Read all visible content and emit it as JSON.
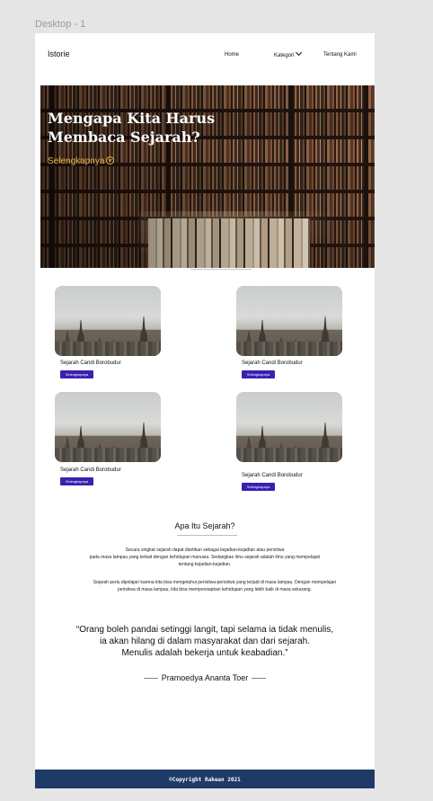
{
  "frame_label": "Desktop - 1",
  "nav": {
    "logo": "Istorie",
    "home": "Home",
    "kategori": "Kategori",
    "about": "Tentang Kami"
  },
  "hero": {
    "title": "Mengapa Kita Harus Membaca Sejarah?",
    "link": "Selengkapnya"
  },
  "cards": [
    {
      "title": "Sejarah Candi Borobudur",
      "button": "Selengkapnya"
    },
    {
      "title": "Sejarah Candi Borobudur",
      "button": "Selengkapnya"
    },
    {
      "title": "Sejarah Candi Borobudur",
      "button": "Selengkapnya"
    },
    {
      "title": "Sejarah Candi Borobudur",
      "button": "Selengkapnya"
    }
  ],
  "about": {
    "title": "Apa Itu Sejarah?",
    "para1_line1": "Secara singkat sejarah dapat diartikan sebagai kejadian-kejadian atau peristiwa",
    "para1_line2": "pada masa lampau yang terkait dengan kehidupan manusia. Sedangkan ilmu sejarah adalah ilmu yang mempelajari",
    "para1_line3": "tentang kejadian-kejadian.",
    "para2_line1": "Sejarah perlu dipelajari karena kita bisa mengetahui peristiwa-peristiwa yang terjadi di masa lampau. Dengan mempelajari",
    "para2_line2": "peristiwa di masa lampau, kita bisa mempersiapkan kehidupan yang lebih baik di masa sekarang."
  },
  "quote": {
    "line1": "“Orang boleh pandai setinggi langit, tapi selama ia tidak menulis,",
    "line2": "ia akan hilang di dalam masyarakat dan dari sejarah.",
    "line3": "Menulis adalah bekerja untuk keabadian.”",
    "author": "Pramoedya Ananta Toer"
  },
  "footer": {
    "text": "©Copyright Rakean 2021"
  },
  "colors": {
    "accent_button": "#3b1fb0",
    "hero_link": "#e6b24a",
    "footer_bg": "#1e3a66"
  }
}
